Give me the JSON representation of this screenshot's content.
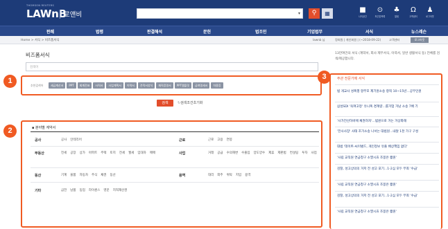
{
  "header": {
    "logo_sub": "THOMSON REUTERS",
    "logo": "LAWnB",
    "logo_kr": "로앤비",
    "icons": [
      {
        "name": "my-lawnb-icon",
        "glyph": "■",
        "label": "나의공간"
      },
      {
        "name": "recent-icon",
        "glyph": "⊙",
        "label": "최근본목록"
      },
      {
        "name": "notice-icon",
        "glyph": "♣",
        "label": "알림"
      },
      {
        "name": "support-icon",
        "glyph": "Ω",
        "label": "고객센터"
      },
      {
        "name": "user-icon",
        "glyph": "♟",
        "label": "로그아웃"
      }
    ]
  },
  "nav": [
    "판례",
    "법령",
    "판결해석",
    "문헌",
    "법조인",
    "기업법무",
    "서식",
    "뉴스레슨"
  ],
  "crumb": {
    "path": "Home > 서식 > 비즈폼서식",
    "right": [
      "lawnb 님",
      "정회원 | 개인회원 | (~2018-09-22)",
      "고객센터"
    ],
    "button": "로그아웃"
  },
  "main": {
    "title": "비즈폼서식",
    "search_placeholder": "검색어",
    "tag_label": "추천검색어",
    "tags": [
      "세금계산서",
      "PPT",
      "회계전표",
      "사직서",
      "사업계획서",
      "이력서",
      "견적서양식",
      "재직증명서",
      "PPT템플릿",
      "급여명세서",
      "차용증"
    ],
    "search_button": "검색",
    "reset_label": "검색조건초기화",
    "category_title": "분야별 계약서",
    "categories": [
      {
        "label": "공사",
        "items": [
          "공사",
          "인테리어"
        ]
      },
      {
        "label": "근로",
        "items": [
          "근로",
          "고용",
          "연봉"
        ]
      },
      {
        "label": "부동산",
        "items": [
          "전세",
          "공장",
          "상가",
          "아파트",
          "주택",
          "토지",
          "전세",
          "월세",
          "임대차",
          "매매"
        ]
      },
      {
        "label": "사업",
        "items": [
          "거래",
          "공급",
          "수의해변",
          "수출입",
          "양도양수",
          "제휴",
          "제판법",
          "컨설팅",
          "투자",
          "사업"
        ]
      },
      {
        "label": "동산",
        "items": [
          "기계",
          "물품",
          "자동차",
          "주식",
          "채권",
          "동산"
        ]
      },
      {
        "label": "용역",
        "items": [
          "대리",
          "외주",
          "위탁",
          "지입",
          "용역"
        ]
      },
      {
        "label": "기타",
        "items": [
          "금전",
          "남품",
          "동업",
          "라이센스",
          "영문",
          "지적재산권"
        ]
      }
    ]
  },
  "side": {
    "desc": "13만여건의 서식 (계약서, 회사 제무서식, 이력서, 일반 생활서식 등) 전체를 검색/제공합니다.",
    "title": "주관 전문가에 서식",
    "news": [
      "법 개교사 성폭행 항부모 제기원소송 항적 10~15년...공무인원",
      "삼성SDI '옥여고정' 유니폭 경계량...를거업 거남 소송 7배 기",
      "'사가전산하바에 채권하자'...범원으로 거는 거상화해",
      "'전사사장' 사태 조가소송 나서는 대법원...내달 1천 가구 구성",
      "대법 '데이트-씨이벌드, 개인정보 유출 배상책임 없다'",
      "'사립 교직원 연금청구 소멸시효 조봉은 짧원'",
      "검찰, 성고상의의 거저 전 성고 포기...1-2심 모두 무죄 '수급'",
      "'사립 교직원 연금청구 소멸시효 조봉은 짧원'",
      "검찰, 성고상의의 거저 전 성고 포기...1-2심 모두 무죄 '수급'",
      "'사립 교직원 연금청구 소멸시효 조봉은 짧원'"
    ]
  },
  "badges": [
    "1",
    "2",
    "3"
  ],
  "colors": {
    "header": "#1d3b78",
    "accent": "#f05a22",
    "search": "#e24e2c"
  }
}
